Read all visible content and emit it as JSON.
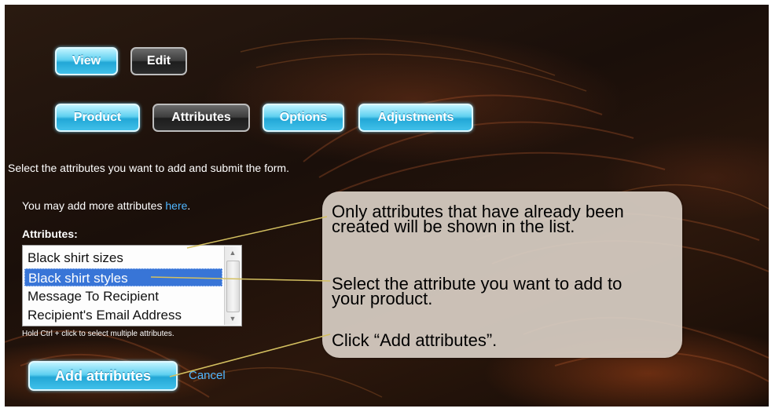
{
  "nav": {
    "top_tabs": [
      {
        "label": "View",
        "style": "blue"
      },
      {
        "label": "Edit",
        "style": "dark"
      }
    ],
    "sub_tabs": [
      {
        "label": "Product",
        "style": "blue"
      },
      {
        "label": "Attributes",
        "style": "dark"
      },
      {
        "label": "Options",
        "style": "blue"
      },
      {
        "label": "Adjustments",
        "style": "blue"
      }
    ]
  },
  "form": {
    "instruction": "Select the attributes you want to add and submit the form.",
    "more_prefix": "You may add more attributes ",
    "more_link": "here",
    "more_suffix": ".",
    "attributes_label": "Attributes:",
    "options": [
      "Black shirt sizes",
      "Black shirt styles",
      "Message To Recipient",
      "Recipient's Email Address"
    ],
    "selected_option": "Black shirt styles",
    "hint": "Hold Ctrl + click to select multiple attributes.",
    "submit_label": "Add attributes",
    "cancel_label": "Cancel"
  },
  "callout": {
    "note1": "Only attributes that have already been created will be shown in the list.",
    "note2": "Select the attribute you want to add to your product.",
    "note3": "Click “Add attributes”."
  },
  "colors": {
    "accent_blue": "#41c1ea",
    "dark_tab": "#2b2b2b",
    "link": "#4fb6ff",
    "selection": "#3875d7",
    "callout_bg": "#d7cec4",
    "pointer_line": "#d4c060"
  },
  "icons": {
    "scroll_up": "scroll-up-arrow-icon",
    "scroll_down": "scroll-down-arrow-icon"
  }
}
